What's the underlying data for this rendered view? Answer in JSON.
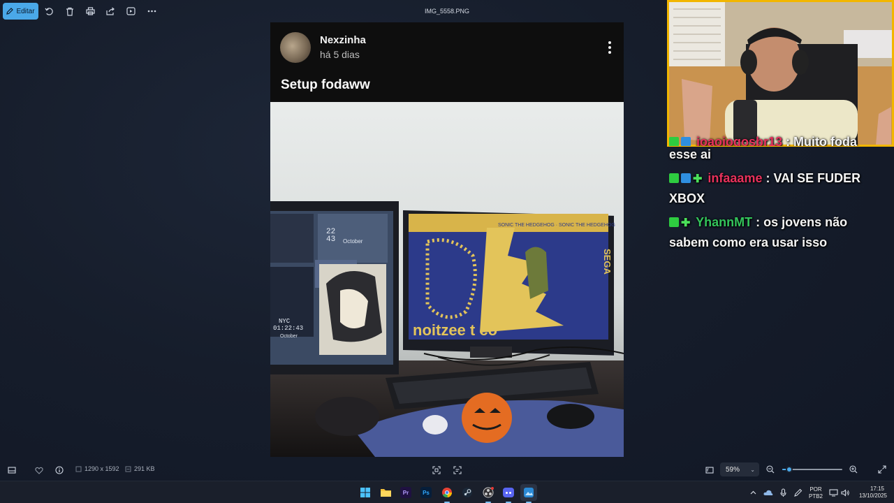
{
  "toolbar": {
    "edit_label": "Editar",
    "icons": [
      "edit-pen-icon",
      "rotate-icon",
      "delete-icon",
      "print-icon",
      "share-icon",
      "slideshow-icon",
      "more-icon"
    ]
  },
  "window": {
    "title": "IMG_5558.PNG"
  },
  "post": {
    "username": "Nexzinha",
    "time": "há 5 dias",
    "caption": "Setup fodaww",
    "photo_texts": {
      "clock_left": "22\n43",
      "month_left": "October",
      "nyc_time": "NYC\n01:22:43",
      "month_left2": "October",
      "right_banner": "SONIC THE HEDGEHOG · SONIC THE HEDGEHOG",
      "right_side": "SEGA",
      "right_bottom": "noitzee t co"
    }
  },
  "chat": {
    "messages": [
      {
        "badges": [
          "k",
          "prime"
        ],
        "user": "joaojogosbr13",
        "user_color": "#e8315c",
        "text": "Muito foda esse ai",
        "cut": true
      },
      {
        "badges": [
          "k",
          "prime",
          "plus"
        ],
        "user": "infaaame",
        "user_color": "#e8315c",
        "text": "VAI SE FUDER XBOX"
      },
      {
        "badges": [
          "k",
          "plus"
        ],
        "user": "YhannMT",
        "user_color": "#33c45b",
        "text": "os jovens não sabem como era usar isso"
      }
    ]
  },
  "statusbar": {
    "dimensions": "1290 x 1592",
    "filesize": "291 KB",
    "zoom": "59%",
    "zoom_fraction": 0.12
  },
  "taskbar": {
    "apps": [
      "windows-start",
      "file-explorer",
      "premiere-pro",
      "photoshop",
      "chrome",
      "steam",
      "obs",
      "discord",
      "photos"
    ],
    "lang_top": "POR",
    "lang_bottom": "PTB2",
    "time": "17:15",
    "date": "13/10/2025"
  },
  "colors": {
    "accent": "#4aa8e8",
    "webcam_border": "#f2b600",
    "badge_green": "#2ecc40"
  }
}
